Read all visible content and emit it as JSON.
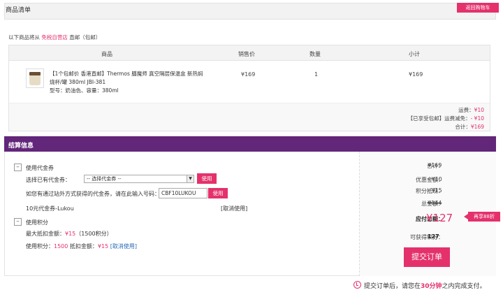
{
  "header": {
    "title": "商品清单",
    "back_button": "返回购物车"
  },
  "ship_info": {
    "prefix": "以下商品将从",
    "store": "免税自营店",
    "suffix": "直邮（包邮）"
  },
  "table": {
    "columns": [
      "商品",
      "销售价",
      "数量",
      "小计"
    ],
    "rows": [
      {
        "name": "【1个包邮价 香港直邮】Thermos 膳魔师 真空隔层保温盒 新热焖烧杯/罐 380ml JBI-381",
        "spec": "型号：奶油色、容量：380ml",
        "price": "¥169",
        "qty": "1",
        "subtotal": "¥169"
      }
    ],
    "summary": {
      "freight_label": "运费：",
      "freight_value": "¥10",
      "discount_label": "【已享受包邮】运费减免：",
      "discount_value": "- ¥10",
      "total_label": "合计：",
      "total_value": "¥169"
    }
  },
  "settle": {
    "title": "结算信息",
    "coupon_toggle": "–",
    "coupon_label": "使用代金券",
    "select_label": "选择已有代金券：",
    "select_value": "-- 选择代金券 --",
    "use_button": "使用",
    "code_label": "如您有通过站外方式获得的代金券，请在此输入号码：",
    "code_value": "CBF10LUKOU",
    "applied_coupon": "10元代金券-Lukou",
    "cancel_link": "[取消使用]",
    "points_toggle": "–",
    "points_label": "使用积分",
    "max_deduct_label": "最大抵扣金额：",
    "max_deduct_value": "¥15",
    "max_deduct_points": "（1500积分）",
    "points_used_label": "使用积分：",
    "points_used_value": "1500",
    "deduct_label": "抵扣金额：",
    "deduct_value": "¥15",
    "points_cancel": "[取消使用]"
  },
  "totals": {
    "total_label": "合计：",
    "total_value": "¥169",
    "coupon_label": "优惠金额：",
    "coupon_value": "- ¥10",
    "points_label": "积分抵现：",
    "points_value": "- ¥15",
    "sum_label": "总金额：",
    "sum_value": "¥144",
    "pay_label": "应付总额：",
    "pay_value": "¥127",
    "badge": "再享88折",
    "earn_label": "可获得积分：",
    "earn_value": "127",
    "submit": "提交订单"
  },
  "footer": {
    "prefix": "提交订单后，请您在",
    "time": "30分钟",
    "suffix": "之内完成支付。"
  },
  "colors": {
    "accent": "#e4316c",
    "header_purple": "#62267a"
  }
}
